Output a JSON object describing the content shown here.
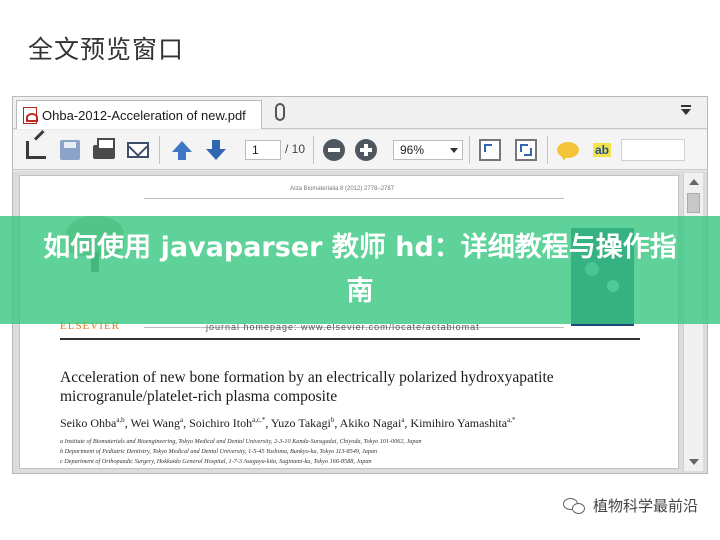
{
  "page": {
    "heading": "全文预览窗口"
  },
  "viewer": {
    "tab": {
      "label": "Ohba-2012-Acceleration of new.pdf"
    },
    "toolbar": {
      "page_current": "1",
      "page_total": "/ 10",
      "zoom": "96%"
    }
  },
  "document": {
    "journal_ref": "Acta Biomaterialia 8 (2012) 2778–2787",
    "logo_word": "ELSEVIER",
    "journal_url": "journal homepage: www.elsevier.com/locate/actabiomat",
    "title": "Acceleration of new bone formation by an electrically polarized hydroxyapatite microgranule/platelet-rich plasma composite",
    "authors": [
      {
        "name": "Seiko Ohba",
        "sup": "a,b"
      },
      {
        "name": "Wei Wang",
        "sup": "a"
      },
      {
        "name": "Soichiro Itoh",
        "sup": "a,c,*"
      },
      {
        "name": "Yuzo Takagi",
        "sup": "b"
      },
      {
        "name": "Akiko Nagai",
        "sup": "a"
      },
      {
        "name": "Kimihiro Yamashita",
        "sup": "a,*"
      }
    ],
    "affiliations": [
      "a Institute of Biomaterials and Bioengineering, Tokyo Medical and Dental University, 2-3-10 Kanda-Surugadai, Chiyoda, Tokyo 101-0062, Japan",
      "b Department of Pediatric Dentistry, Tokyo Medical and Dental University, 1-5-45 Yushima, Bunkyo-ku, Tokyo 113-8549, Japan",
      "c Department of Orthopaedic Surgery, Hokkaido General Hospital, 1-7-3 Asagaya-kita, Suginami-ku, Tokyo 166-8588, Japan"
    ]
  },
  "banner": {
    "text": "如何使用 javaparser 教师 hd：详细教程与操作指南"
  },
  "watermark": {
    "text": "植物科学最前沿"
  },
  "colors": {
    "banner": "#3cc882",
    "logo_orange": "#e8761e",
    "accent_blue": "#2f67b3"
  }
}
